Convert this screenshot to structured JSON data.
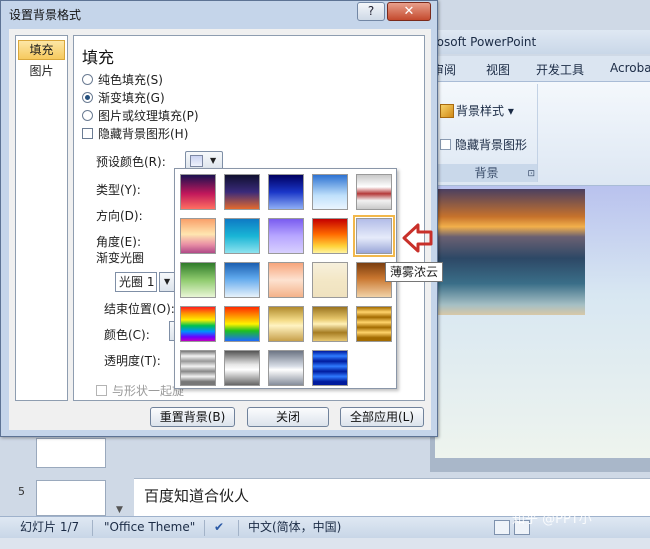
{
  "ppt": {
    "title": "rosoft PowerPoint",
    "tabs": [
      "审阅",
      "视图",
      "开发工具",
      "Acroba"
    ],
    "ribbon": {
      "bg_styles_label": "背景样式 ▾",
      "hide_bg_graphics_label": "隐藏背景图形",
      "group_label": "背景",
      "launcher": "⊡"
    },
    "notes_text": "百度知道合伙人",
    "slide_numbers": [
      "5"
    ],
    "status": {
      "slide": "幻灯片 1/7",
      "theme": "\"Office Theme\"",
      "language": "中文(简体，中国)"
    },
    "watermark": "知乎 @PPT小"
  },
  "dialog": {
    "title": "设置背景格式",
    "help": "?",
    "close": "✕",
    "nav": [
      {
        "label": "填充",
        "active": true
      },
      {
        "label": "图片",
        "active": false
      }
    ],
    "heading": "填充",
    "fill_options": [
      {
        "label": "纯色填充(S)",
        "selected": false
      },
      {
        "label": "渐变填充(G)",
        "selected": true
      },
      {
        "label": "图片或纹理填充(P)",
        "selected": false
      }
    ],
    "hide_bg_graphics": "隐藏背景图形(H)",
    "preset_colors_label": "预设颜色(R):",
    "type_label": "类型(Y):",
    "direction_label": "方向(D):",
    "angle_label": "角度(E):",
    "gradient_stops_label": "渐变光圈",
    "stop_value": "光圈 1",
    "end_position_label": "结束位置(O):",
    "color_label": "颜色(C):",
    "transparency_label": "透明度(T):",
    "rotate_with_shape_label": "与形状一起旋",
    "buttons": {
      "reset": "重置背景(B)",
      "close": "关闭",
      "apply_all": "全部应用(L)"
    }
  },
  "gallery": {
    "tooltip": "薄雾浓云",
    "selected_index": 9,
    "presets": [
      "linear-gradient(180deg,#1a1050,#c2185b 55%,#ff6f61)",
      "linear-gradient(180deg,#101030,#3a2a7a 50%,#e36a2e)",
      "linear-gradient(180deg,#000060,#1a36c8 50%,#8faff5)",
      "linear-gradient(180deg,#2d72d2,#bfe0fb 60%,#eaf5ff)",
      "linear-gradient(180deg,#c9c9c9,#ffffff 35%,#b53a3a 55%,#f2f2f2 75%,#c9c9c9)",
      "linear-gradient(180deg,#f9a06a,#ffe6b0 45%,#e98fa5 75%,#b04a87)",
      "linear-gradient(180deg,#0e7ac4,#19b5d5 50%,#8ee3ef)",
      "linear-gradient(180deg,#7a5cf0,#b7a6ff 50%,#d8d0ff)",
      "linear-gradient(180deg,#c40000,#ff6a00 45%,#ffd33a 80%,#fff3a0)",
      "linear-gradient(180deg,#b3bde8,#e6ebfa 55%,#9aa6d8)",
      "linear-gradient(180deg,#2f7a2a,#8fcb6e 50%,#e9f6d6)",
      "linear-gradient(180deg,#1c5fb0,#5fa8ec 45%,#e7f2fb)",
      "linear-gradient(180deg,#f7a57c,#fde2d0 50%,#f4b28a)",
      "linear-gradient(180deg,#f7f0dc,#f3e7c6 50%,#efe2bf)",
      "linear-gradient(180deg,#7a3e10,#c9762f 45%,#f2d2a7)",
      "linear-gradient(180deg,#ff1e1e,#ff9900 20%,#ffee00 38%,#00c050 55%,#0090ff 72%,#6a00ff 88%,#c000c0)",
      "linear-gradient(180deg,#ff2a00,#ffa100 30%,#fff200 50%,#1ec01e 70%,#1e6aff)",
      "linear-gradient(180deg,#b08a2e,#f5dd8a 40%,#fff3c2 55%,#c7a04a)",
      "linear-gradient(180deg,#9a7420,#e6c66a 35%,#fff1b8 50%,#a67c22 75%,#e8c770)",
      "linear-gradient(180deg,#a36b00,#ffd36a 15%,#a36b00 30%,#ffd36a 45%,#a36b00 60%,#ffd36a 75%,#a36b00 90%)",
      "linear-gradient(180deg,#777,#f2f2f2 15%,#999 30%,#f2f2f2 45%,#888 60%,#f2f2f2 75%,#777 90%)",
      "linear-gradient(180deg,#555,#e6e6e6 40%,#ffffff 55%,#666)",
      "linear-gradient(180deg,#6d7584,#d8dde6 45%,#ffffff 55%,#858d9b)",
      "linear-gradient(180deg,#001b9e,#2f7bff 15%,#001b9e 30%,#2f7bff 45%,#001b9e 60%,#2f7bff 75%,#001b9e 90%)"
    ]
  },
  "colors": {
    "accent_red": "#c8302a",
    "nav_active": "#f6c95e",
    "dialog_frame": "#c5d5ea"
  }
}
